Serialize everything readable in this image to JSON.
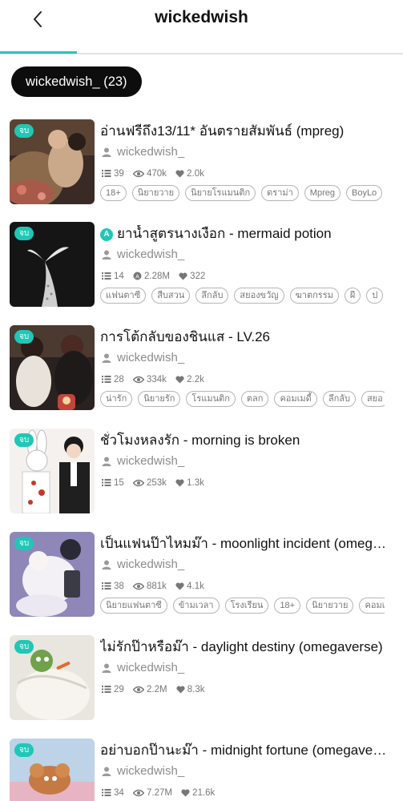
{
  "header": {
    "title": "wickedwish",
    "back_icon": "chevron-left-icon"
  },
  "user_chip": {
    "label": "wickedwish_ (23)"
  },
  "stories": [
    {
      "badge": "จบ",
      "title": "อ่านฟรีถึง13/11* อันตรายสัมพันธ์ (mpreg)",
      "title_badge": "",
      "author": "wickedwish_",
      "chapters": "39",
      "views": "470k",
      "likes": "2.0k",
      "tags": [
        "18+",
        "นิยายวาย",
        "นิยายโรแมนติก",
        "ดราม่า",
        "Mpreg",
        "BoyLo"
      ]
    },
    {
      "badge": "จบ",
      "title": "ยาน้ำสูตรนางเงือก - mermaid potion",
      "title_badge": "A",
      "author": "wickedwish_",
      "chapters": "14",
      "views": "2.28M",
      "likes": "322",
      "tags": [
        "แฟนตาซี",
        "สืบสวน",
        "ลึกลับ",
        "สยองขวัญ",
        "ฆาตกรรม",
        "ผี",
        "ป"
      ]
    },
    {
      "badge": "จบ",
      "title": "การโต้กลับของชินแส - LV.26",
      "title_badge": "",
      "author": "wickedwish_",
      "chapters": "28",
      "views": "334k",
      "likes": "2.2k",
      "tags": [
        "น่ารัก",
        "นิยายรัก",
        "โรแมนติก",
        "ตลก",
        "คอมเมดี้",
        "ลึกลับ",
        "สยอ"
      ]
    },
    {
      "badge": "จบ",
      "title": "ชั่วโมงหลงรัก - morning is broken",
      "title_badge": "",
      "author": "wickedwish_",
      "chapters": "15",
      "views": "253k",
      "likes": "1.3k",
      "tags": []
    },
    {
      "badge": "จบ",
      "title": "เป็นแฟนป๊าไหมม๊า - moonlight incident (omegaverse)",
      "title_badge": "",
      "author": "wickedwish_",
      "chapters": "38",
      "views": "881k",
      "likes": "4.1k",
      "tags": [
        "นิยายแฟนตาซี",
        "ข้ามเวลา",
        "โรงเรียน",
        "18+",
        "นิยายวาย",
        "คอมเ"
      ]
    },
    {
      "badge": "จบ",
      "title": "ไม่รักป๊าหรือม๊า - daylight destiny (omegaverse)",
      "title_badge": "",
      "author": "wickedwish_",
      "chapters": "29",
      "views": "2.2M",
      "likes": "8.3k",
      "tags": []
    },
    {
      "badge": "จบ",
      "title": "อย่าบอกป๊านะม๊า - midnight fortune (omegaverse)",
      "title_badge": "",
      "author": "wickedwish_",
      "chapters": "34",
      "views": "7.27M",
      "likes": "21.6k",
      "tags": []
    }
  ]
}
